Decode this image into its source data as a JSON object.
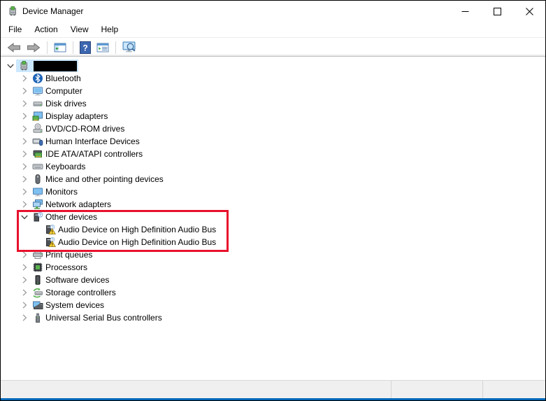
{
  "window": {
    "title": "Device Manager"
  },
  "menu_bar": {
    "items": [
      {
        "label": "File"
      },
      {
        "label": "Action"
      },
      {
        "label": "View"
      },
      {
        "label": "Help"
      }
    ]
  },
  "toolbar": {
    "buttons": [
      "back",
      "forward",
      "separator",
      "show-hide-console-tree",
      "separator",
      "help",
      "show-action-pane",
      "separator",
      "scan-for-hardware-changes"
    ]
  },
  "tree": {
    "root": {
      "label_redacted": true,
      "icon": "computer-root",
      "expander": "expanded",
      "selected": true
    },
    "items": [
      {
        "label": "Bluetooth",
        "icon": "bluetooth",
        "level": 1,
        "expander": "collapsed"
      },
      {
        "label": "Computer",
        "icon": "computer-monitor",
        "level": 1,
        "expander": "collapsed"
      },
      {
        "label": "Disk drives",
        "icon": "disk-drive",
        "level": 1,
        "expander": "collapsed"
      },
      {
        "label": "Display adapters",
        "icon": "display-adapter",
        "level": 1,
        "expander": "collapsed"
      },
      {
        "label": "DVD/CD-ROM drives",
        "icon": "optical-drive",
        "level": 1,
        "expander": "collapsed"
      },
      {
        "label": "Human Interface Devices",
        "icon": "hid-device",
        "level": 1,
        "expander": "collapsed"
      },
      {
        "label": "IDE ATA/ATAPI controllers",
        "icon": "ide-controller",
        "level": 1,
        "expander": "collapsed"
      },
      {
        "label": "Keyboards",
        "icon": "keyboard",
        "level": 1,
        "expander": "collapsed"
      },
      {
        "label": "Mice and other pointing devices",
        "icon": "mouse",
        "level": 1,
        "expander": "collapsed"
      },
      {
        "label": "Monitors",
        "icon": "monitor",
        "level": 1,
        "expander": "collapsed"
      },
      {
        "label": "Network adapters",
        "icon": "network-adapter",
        "level": 1,
        "expander": "collapsed"
      },
      {
        "label": "Other devices",
        "icon": "unknown-device",
        "level": 1,
        "expander": "expanded"
      },
      {
        "label": "Audio Device on High Definition Audio Bus",
        "icon": "unknown-device-warning",
        "level": 2,
        "expander": "none"
      },
      {
        "label": "Audio Device on High Definition Audio Bus",
        "icon": "unknown-device-warning",
        "level": 2,
        "expander": "none"
      },
      {
        "label": "Print queues",
        "icon": "printer",
        "level": 1,
        "expander": "collapsed"
      },
      {
        "label": "Processors",
        "icon": "processor",
        "level": 1,
        "expander": "collapsed"
      },
      {
        "label": "Software devices",
        "icon": "software-device",
        "level": 1,
        "expander": "collapsed"
      },
      {
        "label": "Storage controllers",
        "icon": "storage-controller",
        "level": 1,
        "expander": "collapsed"
      },
      {
        "label": "System devices",
        "icon": "system-device",
        "level": 1,
        "expander": "collapsed"
      },
      {
        "label": "Universal Serial Bus controllers",
        "icon": "usb-controller",
        "level": 1,
        "expander": "collapsed"
      }
    ]
  },
  "highlight_box": {
    "color": "#e8112d"
  },
  "status_bar": {
    "left": "",
    "middle": "",
    "right": ""
  }
}
